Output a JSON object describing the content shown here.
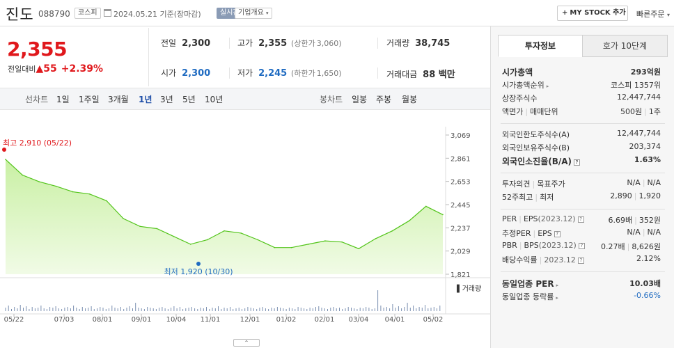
{
  "header": {
    "name": "진도",
    "code": "088790",
    "market": "코스피",
    "date_text": "2024.05.21  기준(장마감)",
    "live": "실시간",
    "company_info": "기업개요",
    "mystock": "MY STOCK 추가",
    "quick_order": "빠른주문"
  },
  "price": {
    "current": "2,355",
    "delta_label": "전일대비",
    "delta_value": "55",
    "delta_pct": "+2.39%",
    "up_color": "#e0181c"
  },
  "stats": {
    "prev_label": "전일",
    "prev": "2,300",
    "high_label": "고가",
    "high": "2,355",
    "upper_label": "(상한가",
    "upper": "3,060)",
    "volume_label": "거래량",
    "volume": "38,745",
    "open_label": "시가",
    "open": "2,300",
    "low_label": "저가",
    "low": "2,245",
    "lower_label": "(하한가",
    "lower": "1,650)",
    "amount_label": "거래대금",
    "amount": "88 백만"
  },
  "period_tabs": {
    "line_chart": "선차트",
    "items": [
      "1일",
      "1주일",
      "3개월",
      "1년",
      "3년",
      "5년",
      "10년"
    ],
    "active": "1년",
    "candle_chart": "봉차트",
    "candle_items": [
      "일봉",
      "주봉",
      "월봉"
    ]
  },
  "chart_data": {
    "type": "area",
    "x": [
      "05/22",
      "06/05",
      "06/19",
      "07/03",
      "07/17",
      "07/31",
      "08/14",
      "08/28",
      "09/11",
      "09/25",
      "10/10",
      "10/24",
      "11/07",
      "11/21",
      "12/05",
      "12/19",
      "01/03",
      "01/17",
      "01/31",
      "02/14",
      "02/28",
      "03/13",
      "03/27",
      "04/10",
      "04/24",
      "05/08",
      "05/21"
    ],
    "y": [
      2850,
      2710,
      2650,
      2610,
      2560,
      2540,
      2480,
      2320,
      2250,
      2230,
      2160,
      2090,
      2130,
      2210,
      2190,
      2130,
      2060,
      2060,
      2090,
      2120,
      2110,
      2050,
      2140,
      2210,
      2300,
      2430,
      2355
    ],
    "yticks": [
      "3,069",
      "2,861",
      "2,653",
      "2,445",
      "2,237",
      "2,029",
      "1,821"
    ],
    "ylim": [
      1821,
      3069
    ],
    "xticks": [
      "05/22",
      "07/03",
      "08/01",
      "09/01",
      "10/04",
      "11/01",
      "12/01",
      "01/02",
      "02/01",
      "03/04",
      "04/01",
      "05/02"
    ],
    "max_label": "최고 2,910 (05/22)",
    "min_label": "최저 1,920 (10/30)",
    "volume_label": "거래량",
    "line_color": "#52c41a",
    "max_color": "#e0181c",
    "min_color": "#1f6bc1"
  },
  "right_panel": {
    "tab_active": "투자정보",
    "tab_other": "호가 10단계",
    "market_cap_label": "시가총액",
    "market_cap": "293억원",
    "rank_label": "시가총액순위",
    "rank": "코스피 1357위",
    "shares_label": "상장주식수",
    "shares": "12,447,744",
    "par_label": "액면가",
    "trade_unit_label": "매매단위",
    "par": "500원",
    "trade_unit": "1주",
    "foreign_limit_label": "외국인한도주식수(A)",
    "foreign_limit": "12,447,744",
    "foreign_hold_label": "외국인보유주식수(B)",
    "foreign_hold": "203,374",
    "foreign_ratio_label": "외국인소진율(B/A)",
    "foreign_ratio": "1.63%",
    "opinion_label": "투자의견",
    "target_label": "목표주가",
    "opinion": "N/A",
    "target": "N/A",
    "w52_high_label": "52주최고",
    "w52_low_label": "최저",
    "w52_high": "2,890",
    "w52_low": "1,920",
    "per_label": "PER",
    "eps_label": "EPS",
    "eps_period": "(2023.12)",
    "per": "6.69배",
    "eps": "352원",
    "est_per_label": "추정PER",
    "est_eps_label": "EPS",
    "est_per": "N/A",
    "est_eps": "N/A",
    "pbr_label": "PBR",
    "bps_label": "BPS",
    "bps_period": "(2023.12)",
    "pbr": "0.27배",
    "bps": "8,626원",
    "div_label": "배당수익률",
    "div_period": "2023.12",
    "div": "2.12%",
    "ind_per_label": "동일업종 PER",
    "ind_per": "10.03배",
    "ind_rate_label": "동일업종 등락률",
    "ind_rate": "-0.66%"
  }
}
